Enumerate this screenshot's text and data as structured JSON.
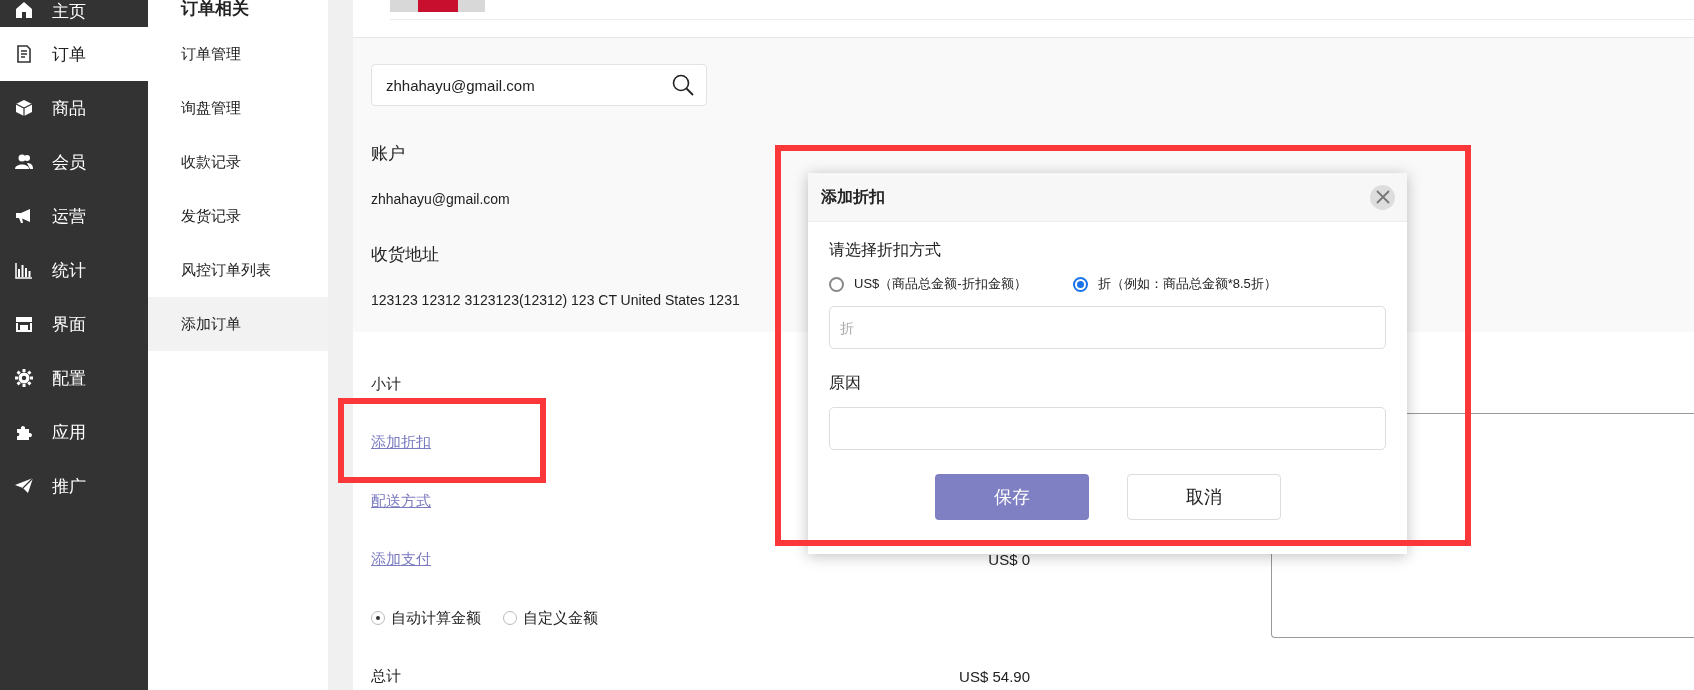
{
  "sidebar": {
    "items": [
      {
        "label": "主页",
        "selected": false
      },
      {
        "label": "订单",
        "selected": true
      },
      {
        "label": "商品",
        "selected": false
      },
      {
        "label": "会员",
        "selected": false
      },
      {
        "label": "运营",
        "selected": false
      },
      {
        "label": "统计",
        "selected": false
      },
      {
        "label": "界面",
        "selected": false
      },
      {
        "label": "配置",
        "selected": false
      },
      {
        "label": "应用",
        "selected": false
      },
      {
        "label": "推广",
        "selected": false
      }
    ]
  },
  "submenu": {
    "title": "订单相关",
    "items": [
      {
        "label": "订单管理",
        "selected": false
      },
      {
        "label": "询盘管理",
        "selected": false
      },
      {
        "label": "收款记录",
        "selected": false
      },
      {
        "label": "发货记录",
        "selected": false
      },
      {
        "label": "风控订单列表",
        "selected": false
      },
      {
        "label": "添加订单",
        "selected": true
      }
    ]
  },
  "customer": {
    "search": {
      "value": "zhhahayu@gmail.com"
    },
    "account_label": "账户",
    "account": "zhhahayu@gmail.com",
    "address_label": "收货地址",
    "address": "123123 12312 3123123(12312) 123 CT United States 1231"
  },
  "summary": {
    "subtotal_label": "小计",
    "links": [
      "添加折扣",
      "配送方式",
      "添加支付"
    ],
    "payment_amount": "US$ 0",
    "amount_modes": [
      {
        "label": "自动计算金额",
        "selected": true
      },
      {
        "label": "自定义金额",
        "selected": false
      }
    ],
    "total_label": "总计",
    "total": "US$ 54.90"
  },
  "dialog": {
    "title": "添加折扣",
    "method_label": "请选择折扣方式",
    "methods": [
      {
        "label": "US$（商品总金额-折扣金额）",
        "selected": false
      },
      {
        "label": "折（例如：商品总金额*8.5折）",
        "selected": true
      }
    ],
    "discount_field": {
      "placeholder": "折"
    },
    "reason_label": "原因",
    "buttons": [
      {
        "label": "保存",
        "kind": "primary"
      },
      {
        "label": "取消",
        "kind": "secondary"
      }
    ]
  }
}
